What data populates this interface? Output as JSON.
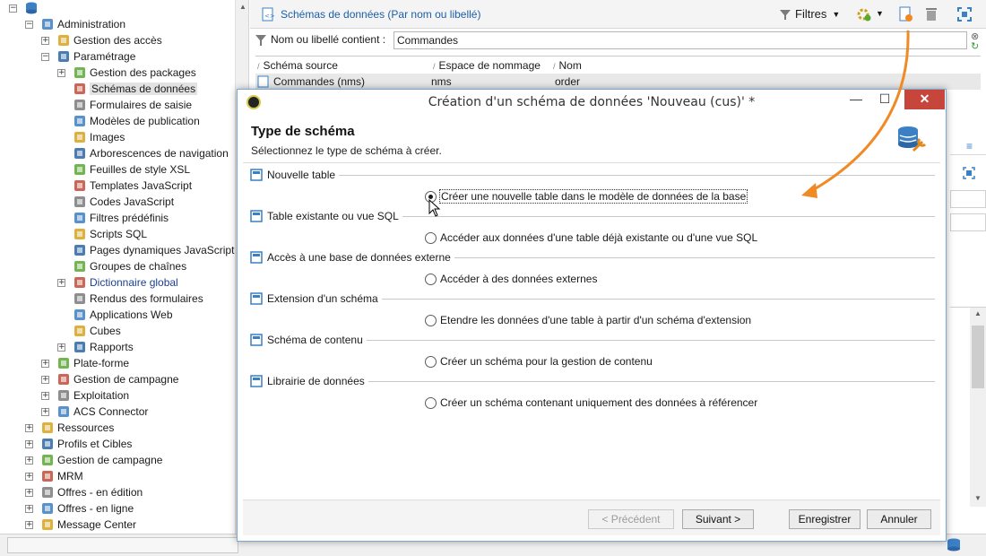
{
  "tree": {
    "root_label": "",
    "items": [
      {
        "label": "Administration",
        "level": 1,
        "expander": "−",
        "icon": "wrench-icon",
        "sel": false,
        "blue": false
      },
      {
        "label": "Gestion des accès",
        "level": 2,
        "expander": "+",
        "icon": "access-icon",
        "sel": false,
        "blue": false
      },
      {
        "label": "Paramétrage",
        "level": 2,
        "expander": "−",
        "icon": "gears-icon",
        "sel": false,
        "blue": false
      },
      {
        "label": "Gestion des packages",
        "level": 3,
        "expander": "+",
        "icon": "package-icon",
        "sel": false,
        "blue": false
      },
      {
        "label": "Schémas de données",
        "level": 3,
        "expander": "",
        "icon": "schema-icon",
        "sel": true,
        "blue": false
      },
      {
        "label": "Formulaires de saisie",
        "level": 3,
        "expander": "",
        "icon": "form-icon",
        "sel": false,
        "blue": false
      },
      {
        "label": "Modèles de publication",
        "level": 3,
        "expander": "",
        "icon": "publication-icon",
        "sel": false,
        "blue": false
      },
      {
        "label": "Images",
        "level": 3,
        "expander": "",
        "icon": "image-icon",
        "sel": false,
        "blue": false
      },
      {
        "label": "Arborescences de navigation",
        "level": 3,
        "expander": "",
        "icon": "navtree-icon",
        "sel": false,
        "blue": false
      },
      {
        "label": "Feuilles de style XSL",
        "level": 3,
        "expander": "",
        "icon": "xsl-icon",
        "sel": false,
        "blue": false
      },
      {
        "label": "Templates JavaScript",
        "level": 3,
        "expander": "",
        "icon": "js-template-icon",
        "sel": false,
        "blue": false
      },
      {
        "label": "Codes JavaScript",
        "level": 3,
        "expander": "",
        "icon": "js-code-icon",
        "sel": false,
        "blue": false
      },
      {
        "label": "Filtres prédéfinis",
        "level": 3,
        "expander": "",
        "icon": "filter-icon",
        "sel": false,
        "blue": false
      },
      {
        "label": "Scripts SQL",
        "level": 3,
        "expander": "",
        "icon": "sql-icon",
        "sel": false,
        "blue": false
      },
      {
        "label": "Pages dynamiques JavaScript",
        "level": 3,
        "expander": "",
        "icon": "js-page-icon",
        "sel": false,
        "blue": false
      },
      {
        "label": "Groupes de chaînes",
        "level": 3,
        "expander": "",
        "icon": "string-group-icon",
        "sel": false,
        "blue": false
      },
      {
        "label": "Dictionnaire global",
        "level": 3,
        "expander": "+",
        "icon": "dictionary-icon",
        "sel": false,
        "blue": true
      },
      {
        "label": "Rendus des formulaires",
        "level": 3,
        "expander": "",
        "icon": "form-render-icon",
        "sel": false,
        "blue": false
      },
      {
        "label": "Applications Web",
        "level": 3,
        "expander": "",
        "icon": "webapp-icon",
        "sel": false,
        "blue": false
      },
      {
        "label": "Cubes",
        "level": 3,
        "expander": "",
        "icon": "cube-icon",
        "sel": false,
        "blue": false
      },
      {
        "label": "Rapports",
        "level": 3,
        "expander": "+",
        "icon": "report-icon",
        "sel": false,
        "blue": false
      },
      {
        "label": "Plate-forme",
        "level": 2,
        "expander": "+",
        "icon": "platform-icon",
        "sel": false,
        "blue": false
      },
      {
        "label": "Gestion de campagne",
        "level": 2,
        "expander": "+",
        "icon": "campaign-icon",
        "sel": false,
        "blue": false
      },
      {
        "label": "Exploitation",
        "level": 2,
        "expander": "+",
        "icon": "operation-icon",
        "sel": false,
        "blue": false
      },
      {
        "label": "ACS Connector",
        "level": 2,
        "expander": "+",
        "icon": "acs-icon",
        "sel": false,
        "blue": false
      },
      {
        "label": "Ressources",
        "level": 1,
        "expander": "+",
        "icon": "resources-icon",
        "sel": false,
        "blue": false
      },
      {
        "label": "Profils et Cibles",
        "level": 1,
        "expander": "+",
        "icon": "profiles-icon",
        "sel": false,
        "blue": false
      },
      {
        "label": "Gestion de campagne",
        "level": 1,
        "expander": "+",
        "icon": "campaign-icon",
        "sel": false,
        "blue": false
      },
      {
        "label": "MRM",
        "level": 1,
        "expander": "+",
        "icon": "mrm-icon",
        "sel": false,
        "blue": false
      },
      {
        "label": "Offres - en édition",
        "level": 1,
        "expander": "+",
        "icon": "offer-edit-icon",
        "sel": false,
        "blue": false
      },
      {
        "label": "Offres - en ligne",
        "level": 1,
        "expander": "+",
        "icon": "offer-live-icon",
        "sel": false,
        "blue": false
      },
      {
        "label": "Message Center",
        "level": 1,
        "expander": "+",
        "icon": "message-center-icon",
        "sel": false,
        "blue": false
      }
    ]
  },
  "panel": {
    "title": "Schémas de données (Par nom ou libellé)",
    "filtres_label": "Filtres",
    "filter_label": "Nom ou libellé contient :",
    "filter_value": "Commandes",
    "columns": [
      "Schéma source",
      "Espace de nommage",
      "Nom"
    ],
    "row": {
      "source": "Commandes (nms)",
      "namespace": "nms",
      "name": "order"
    }
  },
  "dialog": {
    "title": "Création d'un schéma de données 'Nouveau (cus)' *",
    "heading": "Type de schéma",
    "subtitle": "Sélectionnez le type de schéma à créer.",
    "groups": [
      {
        "title": "Nouvelle table",
        "icon": "new-table-icon",
        "option": "Créer une nouvelle table dans le modèle de données de la base",
        "selected": true
      },
      {
        "title": "Table existante ou vue SQL",
        "icon": "sql-table-icon",
        "option": "Accéder aux données d'une table déjà existante ou d'une vue SQL",
        "selected": false
      },
      {
        "title": "Accès à une base de données externe",
        "icon": "external-db-icon",
        "option": "Accéder à des données externes",
        "selected": false
      },
      {
        "title": "Extension d'un schéma",
        "icon": "extension-icon",
        "option": "Etendre les données d'une table à partir d'un schéma d'extension",
        "selected": false
      },
      {
        "title": "Schéma de contenu",
        "icon": "content-schema-icon",
        "option": "Créer un schéma pour la gestion de contenu",
        "selected": false
      },
      {
        "title": "Librairie de données",
        "icon": "library-icon",
        "option": "Créer un schéma contenant uniquement des données à référencer",
        "selected": false
      }
    ],
    "buttons": {
      "prev": "< Précédent",
      "next": "Suivant >",
      "save": "Enregistrer",
      "cancel": "Annuler"
    }
  },
  "colors": {
    "accent_orange": "#f08a24",
    "link_blue": "#1c5fa8",
    "close_red": "#c7463c"
  }
}
